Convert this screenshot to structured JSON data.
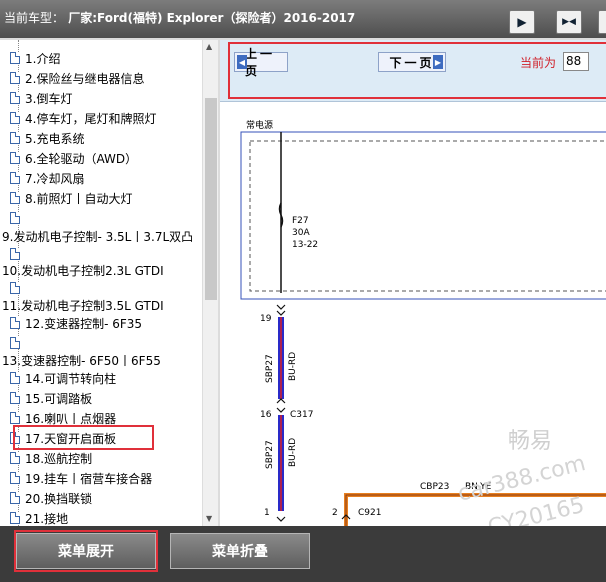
{
  "header": {
    "vehicle_label": "当前车型：",
    "vehicle_name": "厂家:Ford(福特) Explorer（探险者）2016-2017"
  },
  "toolbar": {
    "btn1_glyph": "▶",
    "btn2_glyph": "▶◀",
    "btn3_glyph": "◀"
  },
  "sidebar": {
    "items": [
      {
        "label": "1.介绍"
      },
      {
        "label": "2.保险丝与继电器信息"
      },
      {
        "label": "3.倒车灯"
      },
      {
        "label": "4.停车灯，尾灯和牌照灯"
      },
      {
        "label": "5.充电系统"
      },
      {
        "label": "6.全轮驱动（AWD）"
      },
      {
        "label": "7.冷却风扇"
      },
      {
        "label": "8.前照灯丨自动大灯"
      },
      {
        "label": ""
      },
      {
        "label": "9.发动机电子控制- 3.5L丨3.7L双凸"
      },
      {
        "label": ""
      },
      {
        "label": "10.发动机电子控制2.3L GTDI"
      },
      {
        "label": ""
      },
      {
        "label": "11.发动机电子控制3.5L GTDI"
      },
      {
        "label": "12.变速器控制- 6F35"
      },
      {
        "label": ""
      },
      {
        "label": "13.变速器控制- 6F50丨6F55"
      },
      {
        "label": "14.可调节转向柱"
      },
      {
        "label": "15.可调踏板"
      },
      {
        "label": "16.喇叭丨点烟器"
      },
      {
        "label": "17.天窗开启面板"
      },
      {
        "label": "18.巡航控制"
      },
      {
        "label": "19.挂车丨宿营车接合器"
      },
      {
        "label": "20.换挡联锁"
      },
      {
        "label": "21.接地"
      }
    ]
  },
  "nav": {
    "prev_label": "上一页",
    "next_label": "下一页",
    "current_label": "当前为",
    "current_page": "88"
  },
  "diagram": {
    "power_label": "常电源",
    "fuse_name": "F27",
    "fuse_rating": "30A",
    "fuse_loc": "13-22",
    "pin1": "19",
    "wire1_code": "SBP27",
    "wire1_color": "BU-RD",
    "pin2": "16",
    "connector2": "C317",
    "wire2_code": "SBP27",
    "wire2_color": "BU-RD",
    "pin3": "1",
    "pin4": "2",
    "connector4": "C921",
    "wire3_code": "CBP23",
    "wire3_color": "BN-YE",
    "watermark1": "畅易",
    "watermark2": "car388.com",
    "watermark3": "CY20165"
  },
  "bottom": {
    "expand_label": "菜单展开",
    "collapse_label": "菜单折叠"
  }
}
